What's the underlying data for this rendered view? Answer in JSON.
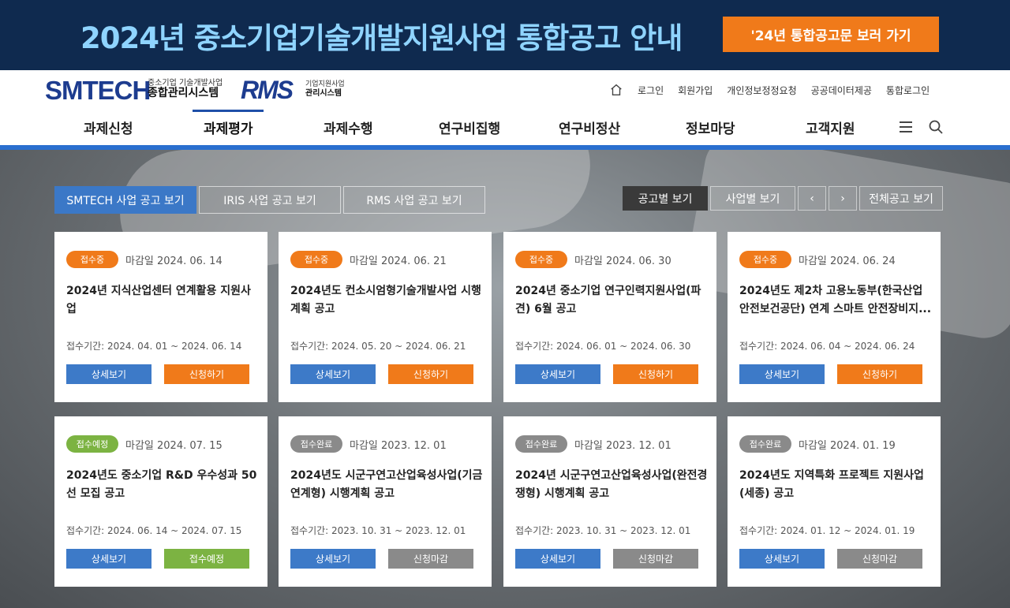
{
  "banner": {
    "title": "2024년 중소기업기술개발지원사업 통합공고 안내",
    "button": "'24년 통합공고문 보러 가기"
  },
  "logo": {
    "smtech": "SMTECH",
    "smtech_sub1": "중소기업 기술개발사업",
    "smtech_sub2": "종합관리시스템",
    "rms": "RMS",
    "rms_sub1": "기업지원사업",
    "rms_sub2": "관리시스템"
  },
  "util": [
    "로그인",
    "회원가입",
    "개인정보정정요청",
    "공공데이터제공",
    "통합로그인"
  ],
  "gnb": [
    "과제신청",
    "과제평가",
    "과제수행",
    "연구비집행",
    "연구비정산",
    "정보마당",
    "고객지원"
  ],
  "tabs": [
    "SMTECH 사업 공고 보기",
    "IRIS 사업 공고 보기",
    "RMS 사업 공고 보기"
  ],
  "right_tabs": {
    "by_notice": "공고별 보기",
    "by_project": "사업별 보기",
    "prev": "‹",
    "next": "›",
    "all": "전체공고 보기"
  },
  "colors": {
    "orange": "#f07a1a",
    "green": "#7cb342",
    "gray": "#8a8a8a",
    "blue": "#3d7ac8"
  },
  "cards": [
    {
      "status": "접수중",
      "deadline": "마감일 2024. 06. 14",
      "title": "2024년 지식산업센터 연계활용 지원사업",
      "period": "접수기간: 2024. 04. 01 ~ 2024. 06. 14",
      "detail": "상세보기",
      "apply": "신청하기"
    },
    {
      "status": "접수중",
      "deadline": "마감일 2024. 06. 21",
      "title": "2024년도 컨소시엄형기술개발사업 시행계획 공고",
      "period": "접수기간: 2024. 05. 20 ~ 2024. 06. 21",
      "detail": "상세보기",
      "apply": "신청하기"
    },
    {
      "status": "접수중",
      "deadline": "마감일 2024. 06. 30",
      "title": "2024년 중소기업 연구인력지원사업(파견) 6월 공고",
      "period": "접수기간: 2024. 06. 01 ~ 2024. 06. 30",
      "detail": "상세보기",
      "apply": "신청하기"
    },
    {
      "status": "접수중",
      "deadline": "마감일 2024. 06. 24",
      "title": "2024년도 제2차 고용노동부(한국산업안전보건공단) 연계 스마트 안전장비지...",
      "period": "접수기간: 2024. 06. 04 ~ 2024. 06. 24",
      "detail": "상세보기",
      "apply": "신청하기"
    },
    {
      "status": "접수예정",
      "deadline": "마감일 2024. 07. 15",
      "title": "2024년도 중소기업 R&D 우수성과 50선 모집 공고",
      "period": "접수기간: 2024. 06. 14 ~ 2024. 07. 15",
      "detail": "상세보기",
      "apply": "접수예정"
    },
    {
      "status": "접수완료",
      "deadline": "마감일 2023. 12. 01",
      "title": "2024년도 시군구연고산업육성사업(기금연계형) 시행계획 공고",
      "period": "접수기간: 2023. 10. 31 ~ 2023. 12. 01",
      "detail": "상세보기",
      "apply": "신청마감"
    },
    {
      "status": "접수완료",
      "deadline": "마감일 2023. 12. 01",
      "title": "2024년 시군구연고산업육성사업(완전경쟁형) 시행계획 공고",
      "period": "접수기간: 2023. 10. 31 ~ 2023. 12. 01",
      "detail": "상세보기",
      "apply": "신청마감"
    },
    {
      "status": "접수완료",
      "deadline": "마감일 2024. 01. 19",
      "title": "2024년도 지역특화 프로젝트 지원사업(세종) 공고",
      "period": "접수기간: 2024. 01. 12 ~ 2024. 01. 19",
      "detail": "상세보기",
      "apply": "신청마감"
    }
  ]
}
